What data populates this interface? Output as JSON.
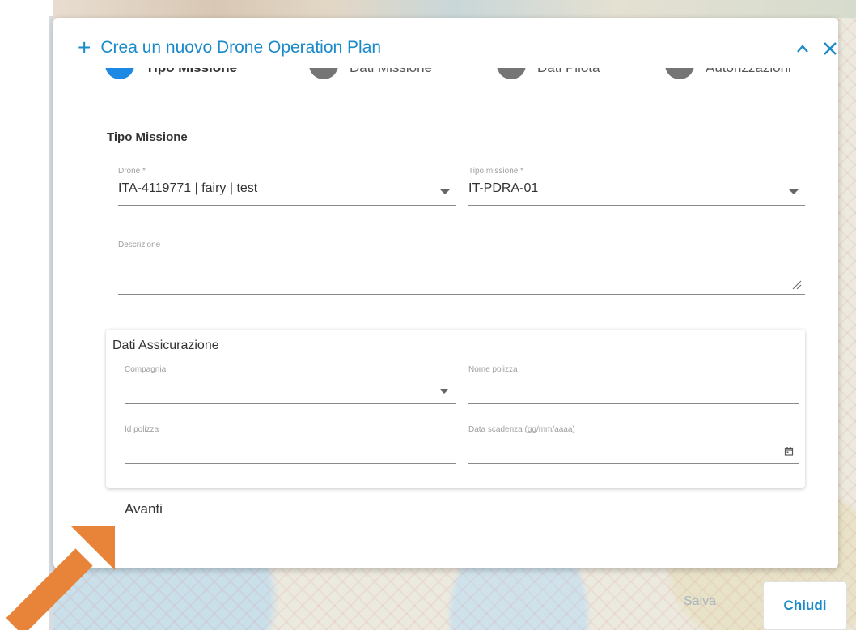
{
  "dialog": {
    "title": "Crea un nuovo Drone Operation Plan",
    "plus_icon": "plus-icon",
    "minimize_icon": "chevron-up-icon",
    "close_icon": "close-icon"
  },
  "stepper": {
    "steps": [
      {
        "label": "Tipo Missione",
        "active": true
      },
      {
        "label": "Dati Missione",
        "active": false
      },
      {
        "label": "Dati Pilota",
        "active": false
      },
      {
        "label": "Autorizzazioni",
        "active": false
      }
    ]
  },
  "form": {
    "section_title": "Tipo Missione",
    "drone": {
      "label": "Drone *",
      "value": "ITA-4119771 | fairy | test"
    },
    "tipo_missione": {
      "label": "Tipo missione *",
      "value": "IT-PDRA-01"
    },
    "descrizione": {
      "label": "Descrizione",
      "value": ""
    }
  },
  "insurance": {
    "title": "Dati Assicurazione",
    "compagnia": {
      "label": "Compagnia",
      "value": ""
    },
    "nome_polizza": {
      "label": "Nome polizza",
      "value": ""
    },
    "id_polizza": {
      "label": "Id polizza",
      "value": ""
    },
    "data_scadenza": {
      "label": "Data scadenza (gg/mm/aaaa)",
      "value": ""
    }
  },
  "actions": {
    "next_label": "Avanti",
    "save_label": "Salva",
    "close_label": "Chiudi"
  },
  "colors": {
    "accent": "#1a8ac9",
    "annotation_arrow": "#e8833a"
  }
}
